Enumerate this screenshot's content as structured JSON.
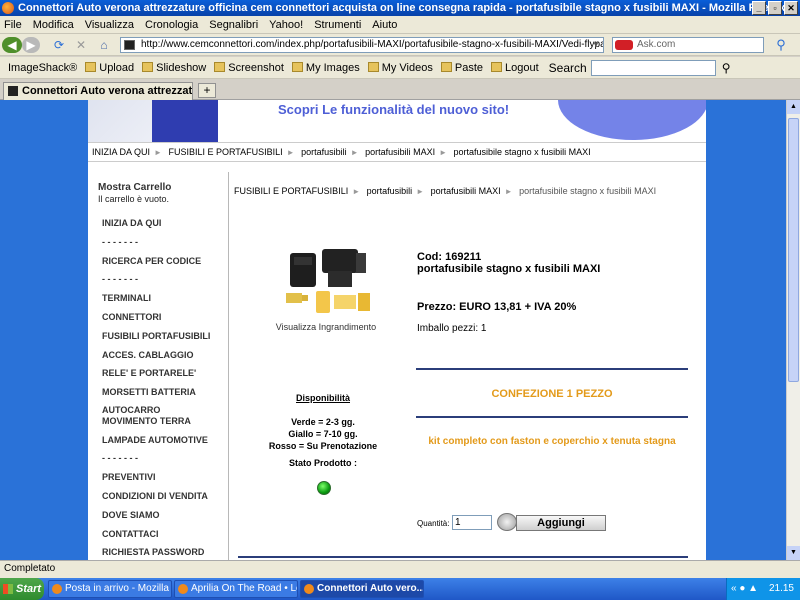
{
  "window": {
    "title": "Connettori Auto verona attrezzature officina cem connettori acquista on line consegna rapida - portafusibile stagno x fusibili MAXI - Mozilla Firefox",
    "controls": [
      "_",
      "▫",
      "✕"
    ]
  },
  "menubar": [
    "File",
    "Modifica",
    "Visualizza",
    "Cronologia",
    "Segnalibri",
    "Yahoo!",
    "Strumenti",
    "Aiuto"
  ],
  "navbar": {
    "url": "http://www.cemconnettori.com/index.php/portafusibili-MAXI/portafusibile-stagno-x-fusibili-MAXI/Vedi-flypage-del",
    "search_placeholder": "Ask.com"
  },
  "bookmarks": {
    "items": [
      "ImageShack®",
      "Upload",
      "Slideshow",
      "Screenshot",
      "My Images",
      "My Videos",
      "Paste",
      "Logout"
    ],
    "search_label": "Search"
  },
  "tabs": {
    "active": "Connettori Auto verona attrezzatur...",
    "new_tab": "+"
  },
  "page": {
    "banner_text": "Scopri Le funzionalità del nuovo sito!",
    "breadcrumb_top": [
      "INIZIA DA QUI",
      "FUSIBILI E PORTAFUSIBILI",
      "portafusibili",
      "portafusibili MAXI",
      "portafusibile stagno x fusibili MAXI"
    ],
    "cart_title": "Mostra Carrello",
    "cart_status": "Il carrello è vuoto.",
    "menu": [
      "INIZIA DA QUI",
      "- - - - - - -",
      "RICERCA PER CODICE",
      "- - - - - - -",
      "TERMINALI",
      "CONNETTORI",
      "FUSIBILI PORTAFUSIBILI",
      "ACCES. CABLAGGIO",
      "RELE' E PORTARELE'",
      "MORSETTI BATTERIA",
      "AUTOCARRO MOVIMENTO TERRA",
      "LAMPADE AUTOMOTIVE",
      "- - - - - - -",
      "PREVENTIVI",
      "CONDIZIONI DI VENDITA",
      "DOVE SIAMO",
      "CONTATTACI",
      "RICHIESTA PASSWORD"
    ],
    "main_crumb": [
      "FUSIBILI E PORTAFUSIBILI",
      "portafusibili",
      "portafusibili MAXI",
      "portafusibile stagno x fusibili MAXI"
    ],
    "image_caption": "Visualizza Ingrandimento",
    "code": "Cod: 169211",
    "product_name": "portafusibile stagno x fusibili MAXI",
    "price": "Prezzo: EURO 13,81 + IVA 20%",
    "packaging": "Imballo pezzi: 1",
    "confezione": "CONFEZIONE  1 PEZZO",
    "description": "kit completo con faston e coperchio x tenuta stagna",
    "availability": {
      "title": "Disponibilità",
      "green": "Verde = 2-3 gg.",
      "yellow": "Giallo = 7-10 gg.",
      "red": "Rosso = Su Prenotazione"
    },
    "stato_label": "Stato Prodotto :",
    "qty_label": "Quantità:",
    "qty_value": "1",
    "add_label": "Aggiungi"
  },
  "statusbar": "Completato",
  "taskbar": {
    "start": "Start",
    "tasks": [
      "Posta in arrivo - Mozilla T...",
      "Aprilia On The Road • Le...",
      "Connettori Auto vero..."
    ],
    "clock": "21.15"
  },
  "colors": {
    "page_bg": "#2a72d8",
    "accent_orange": "#e39a1a",
    "divider_navy": "#2b3e7a",
    "banner_text": "#4e5fd6"
  }
}
